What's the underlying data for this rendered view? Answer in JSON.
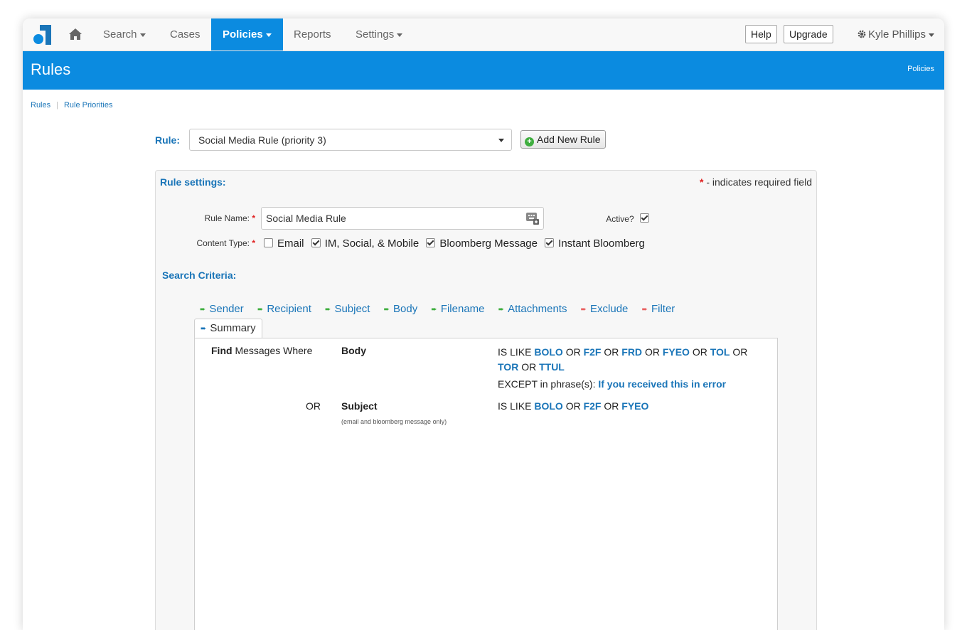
{
  "nav": {
    "search": "Search",
    "cases": "Cases",
    "policies": "Policies",
    "reports": "Reports",
    "settings": "Settings",
    "help": "Help",
    "upgrade": "Upgrade",
    "user": "Kyle Phillips"
  },
  "header": {
    "title": "Rules",
    "link": "Policies"
  },
  "breadcrumb": {
    "rules": "Rules",
    "priorities": "Rule Priorities"
  },
  "rule": {
    "label": "Rule:",
    "selected": "Social Media Rule (priority 3)",
    "add_button": "Add New Rule"
  },
  "panel": {
    "title": "Rule settings:",
    "required_note": "- indicates required field",
    "required_mark": "*",
    "rule_name_label": "Rule Name:",
    "rule_name_value": "Social Media Rule",
    "active_label": "Active?",
    "active_checked": true,
    "content_type_label": "Content Type:",
    "content_types": [
      {
        "label": "Email",
        "checked": false
      },
      {
        "label": "IM, Social, & Mobile",
        "checked": true
      },
      {
        "label": "Bloomberg Message",
        "checked": true
      },
      {
        "label": "Instant Bloomberg",
        "checked": true
      }
    ],
    "search_title": "Search Criteria:"
  },
  "tabs": [
    {
      "label": "Sender",
      "arrow": "green"
    },
    {
      "label": "Recipient",
      "arrow": "green"
    },
    {
      "label": "Subject",
      "arrow": "green"
    },
    {
      "label": "Body",
      "arrow": "green"
    },
    {
      "label": "Filename",
      "arrow": "green"
    },
    {
      "label": "Attachments",
      "arrow": "green"
    },
    {
      "label": "Exclude",
      "arrow": "red"
    },
    {
      "label": "Filter",
      "arrow": "red"
    }
  ],
  "summary": {
    "tab": "Summary",
    "find": "Find",
    "messages_where": "Messages Where",
    "field1": "Body",
    "is_like": "IS LIKE",
    "or": "OR",
    "body_terms": [
      "BOLO",
      "F2F",
      "FRD",
      "FYEO",
      "TOL",
      "TOR",
      "TTUL"
    ],
    "except": "EXCEPT in phrase(s):",
    "except_phrase": "If you received this in error",
    "field2": "Subject",
    "field2_note": "(email and bloomberg message only)",
    "subject_terms": [
      "BOLO",
      "F2F",
      "FYEO"
    ]
  },
  "colors": {
    "brand_blue": "#0b8be0",
    "link_blue": "#1a75b8",
    "green_arrow": "#3fae3f",
    "red_arrow": "#e96060"
  }
}
